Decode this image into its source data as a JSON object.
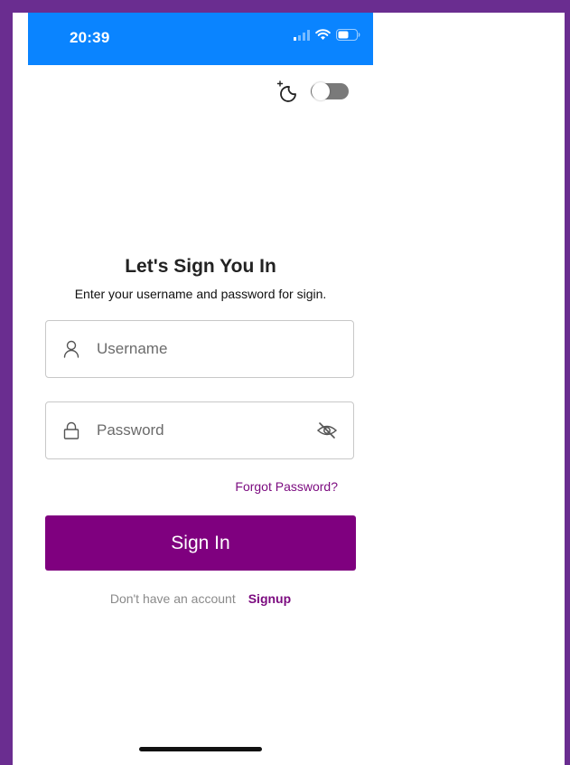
{
  "status_bar": {
    "time": "20:39",
    "icons": [
      "cellular-signal-icon",
      "wifi-icon",
      "battery-icon"
    ],
    "background": "#0a84ff"
  },
  "theme_toggle": {
    "icon": "dark-mode-moon-icon",
    "state": "off"
  },
  "login": {
    "title": "Let's Sign You In",
    "subtitle": "Enter your username and password for sigin.",
    "username": {
      "placeholder": "Username",
      "value": "",
      "icon": "user-icon"
    },
    "password": {
      "placeholder": "Password",
      "value": "",
      "icon": "lock-icon",
      "toggle_icon": "eye-off-icon"
    },
    "forgot_label": "Forgot Password?",
    "signin_label": "Sign In",
    "signup_prompt": "Don't have an account",
    "signup_label": "Signup"
  },
  "colors": {
    "accent": "#7f007f",
    "frame": "#6a2d90"
  }
}
